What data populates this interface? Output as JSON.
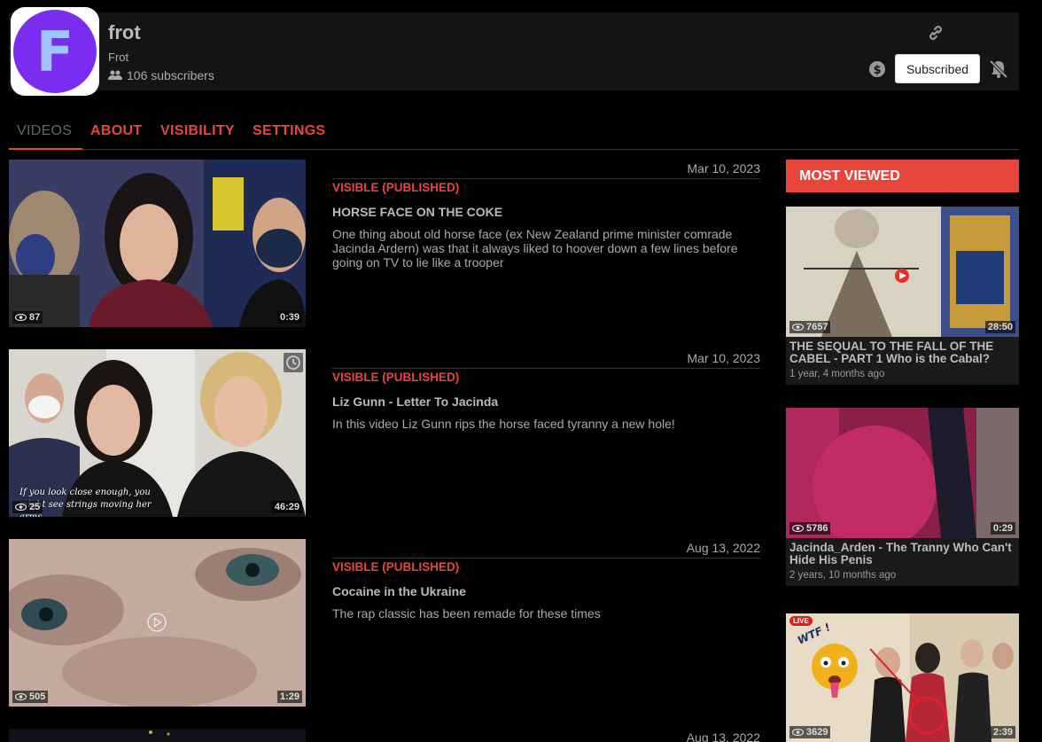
{
  "channel": {
    "name": "frot",
    "handle": "Frot",
    "subscribers": "106 subscribers",
    "subscribe_label": "Subscribed",
    "avatar_letter": "F",
    "avatar_color": "#7a2cf0"
  },
  "tabs": [
    {
      "label": "VIDEOS",
      "active": true
    },
    {
      "label": "ABOUT",
      "active": false
    },
    {
      "label": "VISIBILITY",
      "active": false
    },
    {
      "label": "SETTINGS",
      "active": false
    }
  ],
  "videos": [
    {
      "date": "Mar 10, 2023",
      "status": "VISIBLE (PUBLISHED)",
      "title": "HORSE FACE ON THE COKE",
      "description": "One thing about old horse face (ex New Zealand prime minister comrade Jacinda Ardern) was that it always liked to hoover down a few lines before going on TV to lie like a trooper",
      "views": "87",
      "duration": "0:39"
    },
    {
      "date": "Mar 10, 2023",
      "status": "VISIBLE (PUBLISHED)",
      "title": "Liz Gunn - Letter To Jacinda",
      "description": "In this video Liz Gunn rips the horse faced tyranny a new hole!",
      "views": "25",
      "duration": "46:29",
      "caption": "If you look close enough, you might see strings moving her arms"
    },
    {
      "date": "Aug 13, 2022",
      "status": "VISIBLE (PUBLISHED)",
      "title": "Cocaine in the Ukraine",
      "description": "The rap classic has been remade for these times",
      "views": "505",
      "duration": "1:29"
    },
    {
      "date": "Aug 13, 2022"
    }
  ],
  "sidebar": {
    "header": "MOST VIEWED",
    "items": [
      {
        "title": "THE SEQUAL TO THE FALL OF THE CABEL - PART 1 Who is the Cabal?",
        "age": "1 year, 4 months ago",
        "views": "7657",
        "duration": "28:50"
      },
      {
        "title": "Jacinda_Arden - The Tranny Who Can't Hide His Penis",
        "age": "2 years, 10 months ago",
        "views": "5786",
        "duration": "0:29"
      },
      {
        "views": "3629",
        "duration": "2:39",
        "live_badge": "LIVE",
        "sticker_text": "WTF !"
      }
    ]
  },
  "colors": {
    "accent": "#e8453c",
    "background": "#000000",
    "panel": "#141414"
  }
}
